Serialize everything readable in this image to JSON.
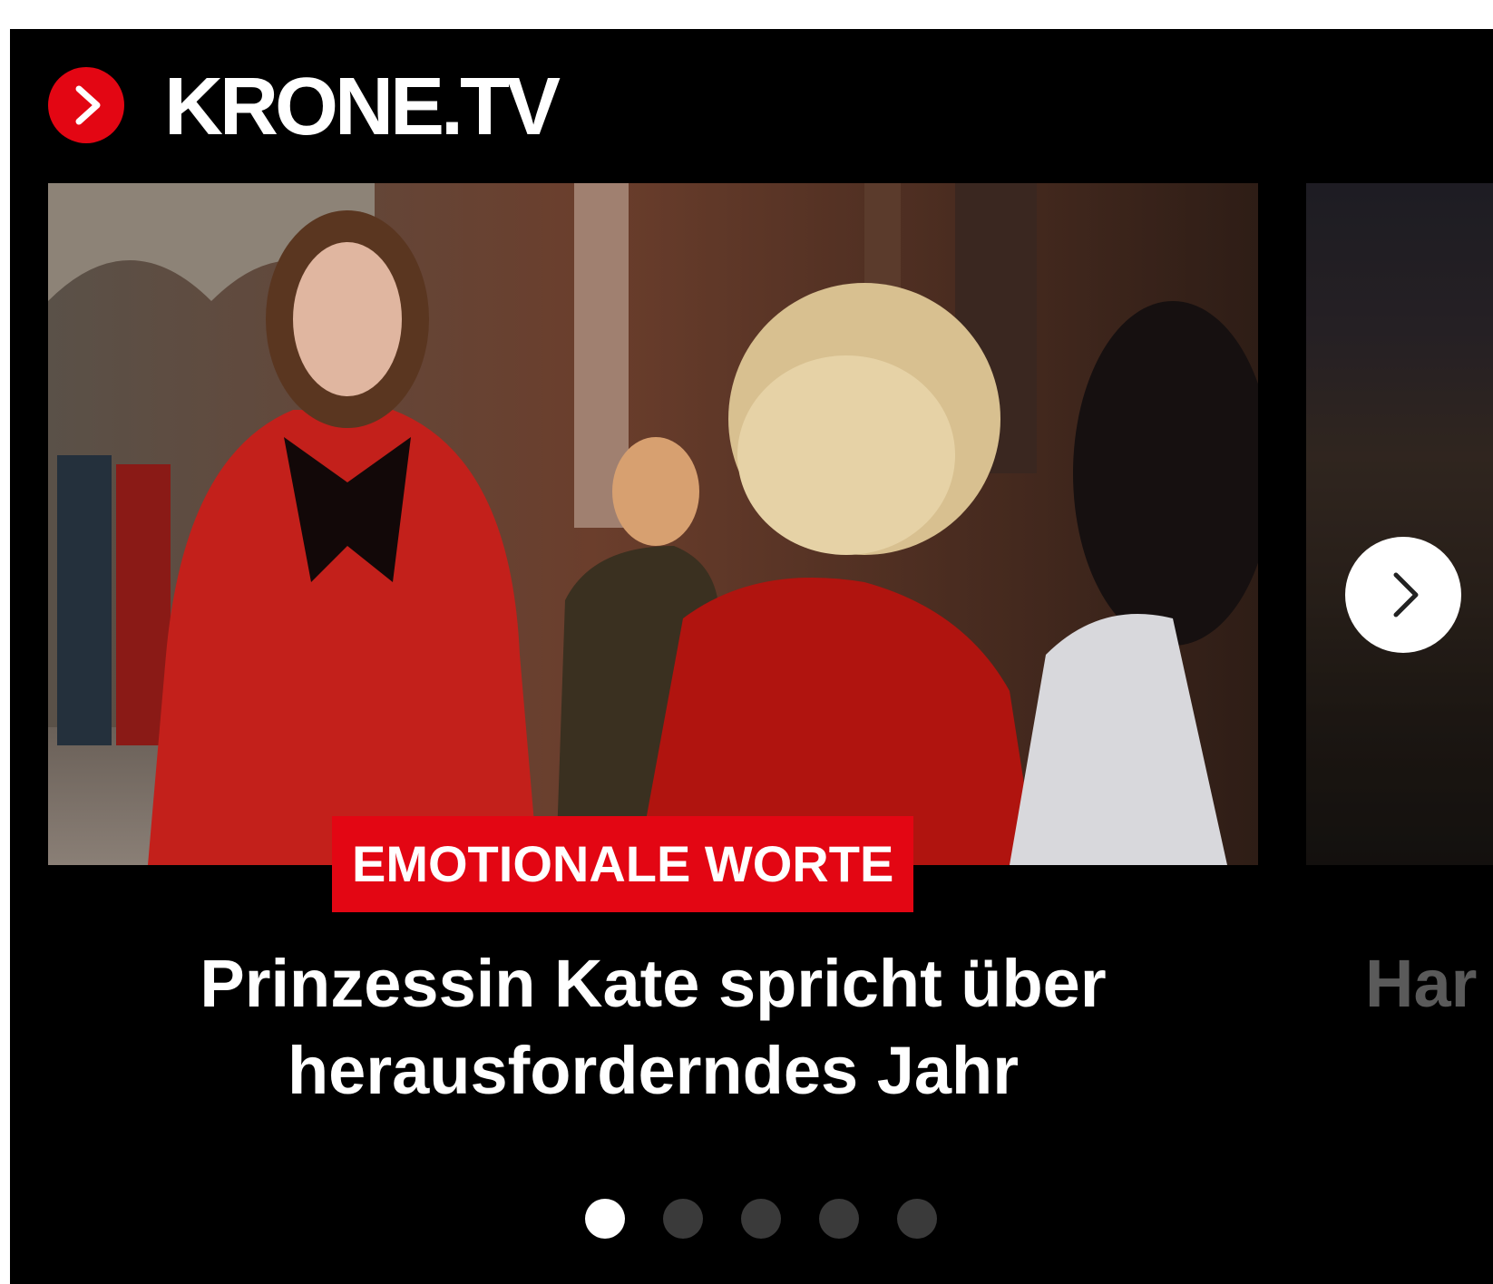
{
  "header": {
    "title": "KRONE.TV",
    "logo_icon": "chevron-right-icon",
    "accent_color": "#e30613"
  },
  "carousel": {
    "slides": [
      {
        "kicker": "EMOTIONALE WORTE",
        "headline": "Prinzessin Kate spricht über herausforderndes Jahr"
      },
      {
        "headline_partial": "Har"
      }
    ],
    "next_button_icon": "chevron-right-icon",
    "dots_count": 5,
    "active_dot": 1
  }
}
